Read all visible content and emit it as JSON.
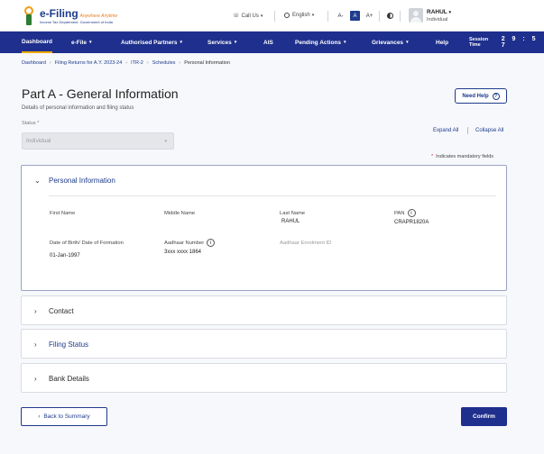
{
  "header": {
    "logo_main": "e-Filing",
    "logo_tagline": "Anywhere Anytime",
    "logo_sub": "Income Tax Department, Government of India",
    "call_us": "Call Us",
    "language": "English",
    "font_small": "A-",
    "font_normal": "A",
    "font_large": "A+",
    "user_name": "RAHUL",
    "user_role": "Individual"
  },
  "nav": {
    "items": [
      "Dashboard",
      "e-File",
      "Authorised Partners",
      "Services",
      "AIS",
      "Pending Actions",
      "Grievances",
      "Help"
    ],
    "session_label": "Session Time",
    "session_digits": "2 9 : 5 7"
  },
  "breadcrumb": [
    "Dashboard",
    "Filing Returns for A.Y. 2023-24",
    "ITR-2",
    "Schedules",
    "Personal Information"
  ],
  "page": {
    "title": "Part A - General Information",
    "subtitle": "Details of personal information and filing status",
    "need_help": "Need Help",
    "status_label": "Status *",
    "status_value": "Individual",
    "expand_all": "Expand All",
    "collapse_all": "Collapse All",
    "mandatory_note": "Indicates mandatory fields"
  },
  "sections": {
    "personal": {
      "title": "Personal Information",
      "first_name_label": "First Name",
      "middle_name_label": "Middle Name",
      "last_name_label": "Last Name",
      "last_name_value": "RAHUL",
      "pan_label": "PAN",
      "pan_value": "CRAPR1820A",
      "dob_label": "Date of Birth/ Date of Formation",
      "dob_value": "01-Jan-1997",
      "aadhaar_label": "Aadhaar Number",
      "aadhaar_value": "3xxx xxxx 1864",
      "aadhaar_enrolment_label": "Aadhaar Enrolment ID"
    },
    "contact": {
      "title": "Contact"
    },
    "filing_status": {
      "title": "Filing Status"
    },
    "bank_details": {
      "title": "Bank Details"
    }
  },
  "footer": {
    "back_label": "Back to Summary",
    "confirm_label": "Confirm"
  },
  "colors": {
    "primary": "#1e2f8d",
    "accent": "#f2a900",
    "mandatory": "#d32f2f"
  }
}
